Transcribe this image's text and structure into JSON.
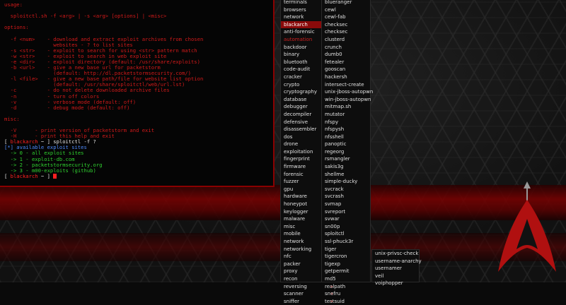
{
  "terminal": {
    "lines": [
      {
        "text": "usage:",
        "cls": "t-red"
      },
      {
        "text": "",
        "cls": "t-red"
      },
      {
        "text": "  sploitctl.sh -f <arg> | -s <arg> [options] | <misc>",
        "cls": "t-red"
      },
      {
        "text": "",
        "cls": "t-red"
      },
      {
        "text": "options:",
        "cls": "t-red"
      },
      {
        "text": "",
        "cls": "t-red"
      },
      {
        "text": "  -f <num>    - download and extract exploit archives from chosen",
        "cls": "t-red"
      },
      {
        "text": "                websites - ? to list sites",
        "cls": "t-red"
      },
      {
        "text": "  -s <str>    - exploit to search for using <str> pattern match",
        "cls": "t-red"
      },
      {
        "text": "  -w <str>    - exploit to search in web exploit site",
        "cls": "t-red"
      },
      {
        "text": "  -e <dir>    - exploit directory (default: /usr/share/exploits)",
        "cls": "t-red"
      },
      {
        "text": "  -b <url>    - give a new base url for packetstorm",
        "cls": "t-red"
      },
      {
        "text": "                (default: http://dl.packetstormsecurity.com/)",
        "cls": "t-red"
      },
      {
        "text": "  -l <file>   - give a new base path/file for website list option",
        "cls": "t-red"
      },
      {
        "text": "                (default: /usr/share/sploitctl/web/url.lst)",
        "cls": "t-red"
      },
      {
        "text": "  -c          - do not delete downloaded archive files",
        "cls": "t-red"
      },
      {
        "text": "  -n          - turn off colors",
        "cls": "t-red"
      },
      {
        "text": "  -v          - verbose mode (default: off)",
        "cls": "t-red"
      },
      {
        "text": "  -d          - debug mode (default: off)",
        "cls": "t-red"
      },
      {
        "text": "",
        "cls": "t-red"
      },
      {
        "text": "misc:",
        "cls": "t-red"
      },
      {
        "text": "",
        "cls": "t-red"
      },
      {
        "text": "  -V      - print version of packetstorm and exit",
        "cls": "t-red"
      },
      {
        "text": "  -H      - print this help and exit",
        "cls": "t-red"
      }
    ],
    "prompt_user": "blackarch",
    "prompt_path": "~",
    "command": "sploitctl -f ?",
    "sites_header": "[*] available exploit sites",
    "sites": [
      "  -> 0 - all exploit sites",
      "  -> 1 - exploit-db.com",
      "  -> 2 - packetstormsecurity.org",
      "  -> 3 - m00-exploits (github)"
    ]
  },
  "menu1": {
    "items": [
      {
        "label": "terminals",
        "arrow": true
      },
      {
        "label": "browsers",
        "arrow": true
      },
      {
        "label": "network",
        "arrow": true
      },
      {
        "label": "blackarch",
        "arrow": true,
        "state": "sel"
      },
      {
        "label": "anti-forensic",
        "arrow": true
      },
      {
        "label": "automation",
        "arrow": true,
        "state": "hl"
      },
      {
        "label": "backdoor",
        "arrow": true
      },
      {
        "label": "binary",
        "arrow": true
      },
      {
        "label": "bluetooth",
        "arrow": true
      },
      {
        "label": "code-audit",
        "arrow": true
      },
      {
        "label": "cracker",
        "arrow": true
      },
      {
        "label": "crypto",
        "arrow": true
      },
      {
        "label": "cryptography",
        "arrow": true
      },
      {
        "label": "database",
        "arrow": true
      },
      {
        "label": "debugger",
        "arrow": true
      },
      {
        "label": "decompiler",
        "arrow": true
      },
      {
        "label": "defensive",
        "arrow": true
      },
      {
        "label": "disassembler",
        "arrow": true
      },
      {
        "label": "dos",
        "arrow": true
      },
      {
        "label": "drone",
        "arrow": true
      },
      {
        "label": "exploitation",
        "arrow": true
      },
      {
        "label": "fingerprint",
        "arrow": true
      },
      {
        "label": "firmware",
        "arrow": true
      },
      {
        "label": "forensic",
        "arrow": true
      },
      {
        "label": "fuzzer",
        "arrow": true
      },
      {
        "label": "gpu",
        "arrow": true
      },
      {
        "label": "hardware",
        "arrow": true
      },
      {
        "label": "honeypot",
        "arrow": true
      },
      {
        "label": "keylogger",
        "arrow": true
      },
      {
        "label": "malware",
        "arrow": true
      },
      {
        "label": "misc",
        "arrow": true
      },
      {
        "label": "mobile",
        "arrow": true
      },
      {
        "label": "network",
        "arrow": true
      },
      {
        "label": "networking",
        "arrow": true
      },
      {
        "label": "nfc",
        "arrow": true
      },
      {
        "label": "packer",
        "arrow": true
      },
      {
        "label": "proxy",
        "arrow": true
      },
      {
        "label": "recon",
        "arrow": true
      },
      {
        "label": "reversing",
        "arrow": true
      },
      {
        "label": "scanner",
        "arrow": true
      },
      {
        "label": "sniffer",
        "arrow": true
      }
    ]
  },
  "menu2": {
    "items": [
      {
        "label": "blueranger"
      },
      {
        "label": "cewl"
      },
      {
        "label": "cewl-fab"
      },
      {
        "label": "checksec"
      },
      {
        "label": "checksec"
      },
      {
        "label": "clusterd"
      },
      {
        "label": "crunch"
      },
      {
        "label": "dumb0"
      },
      {
        "label": "fetealer"
      },
      {
        "label": "gooscan"
      },
      {
        "label": "hackersh"
      },
      {
        "label": "intersect-create"
      },
      {
        "label": "unix-jboss-autopwn"
      },
      {
        "label": "win-jboss-autopwn"
      },
      {
        "label": "mitmap.sh"
      },
      {
        "label": "mutator"
      },
      {
        "label": "nfspy"
      },
      {
        "label": "nfspysh"
      },
      {
        "label": "nfsshell"
      },
      {
        "label": "panoptic"
      },
      {
        "label": "regeorg"
      },
      {
        "label": "rsmangler"
      },
      {
        "label": "sakis3g"
      },
      {
        "label": "shellme"
      },
      {
        "label": "simple-ducky"
      },
      {
        "label": "svcrack"
      },
      {
        "label": "svcrash"
      },
      {
        "label": "svmap"
      },
      {
        "label": "svreport"
      },
      {
        "label": "svwar"
      },
      {
        "label": "sn00p"
      },
      {
        "label": "sploitctl"
      },
      {
        "label": "ssl-phuck3r"
      },
      {
        "label": "tiger"
      },
      {
        "label": "tigercron"
      },
      {
        "label": "tigexp"
      },
      {
        "label": "getpermit"
      },
      {
        "label": "md5"
      },
      {
        "label": "realpath"
      },
      {
        "label": "snefru"
      },
      {
        "label": "testsuid"
      }
    ]
  },
  "menu3": {
    "items": [
      {
        "label": "unix-privsc-check"
      },
      {
        "label": "username-anarchy"
      },
      {
        "label": "usernamer"
      },
      {
        "label": "veil"
      },
      {
        "label": "voiphopper"
      }
    ]
  },
  "colors": {
    "accent": "#8a0a0a",
    "terminal_text": "#d21a1a",
    "highlight": "#cc2020"
  }
}
